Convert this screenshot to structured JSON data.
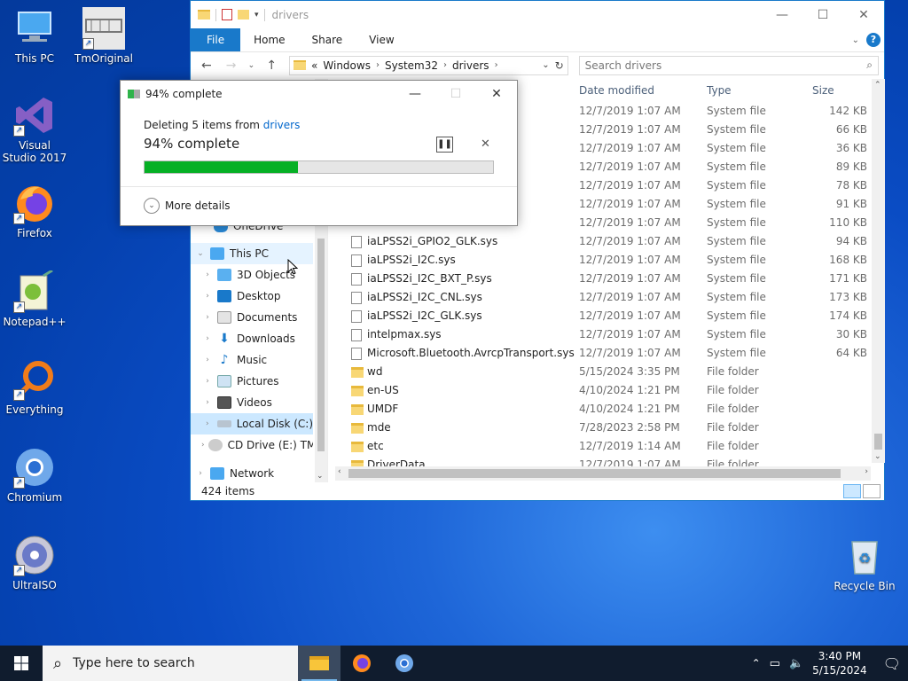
{
  "desktop": {
    "icons": [
      {
        "label": "This PC"
      },
      {
        "label": "TmOriginal"
      },
      {
        "label": "Visual Studio 2017"
      },
      {
        "label": "Firefox"
      },
      {
        "label": "Notepad++"
      },
      {
        "label": "Everything"
      },
      {
        "label": "Chromium"
      },
      {
        "label": "UltraISO"
      },
      {
        "label": "Recycle Bin"
      }
    ]
  },
  "explorer": {
    "title": "drivers",
    "tabs": [
      "File",
      "Home",
      "Share",
      "View"
    ],
    "address": {
      "prefix": "«",
      "crumbs": [
        "Windows",
        "System32",
        "drivers"
      ]
    },
    "search_placeholder": "Search drivers",
    "nav": {
      "onedrive": "OneDrive",
      "this_pc": "This PC",
      "items": [
        "3D Objects",
        "Desktop",
        "Documents",
        "Downloads",
        "Music",
        "Pictures",
        "Videos",
        "Local Disk (C:)",
        "CD Drive (E:) TM"
      ],
      "network": "Network"
    },
    "columns": {
      "date": "Date modified",
      "type": "Type",
      "size": "Size"
    },
    "rows": [
      {
        "name": "",
        "date": "12/7/2019 1:07 AM",
        "type": "System file",
        "size": "142 KB"
      },
      {
        "name": "",
        "date": "12/7/2019 1:07 AM",
        "type": "System file",
        "size": "66 KB"
      },
      {
        "name": "",
        "date": "12/7/2019 1:07 AM",
        "type": "System file",
        "size": "36 KB"
      },
      {
        "name": "",
        "date": "12/7/2019 1:07 AM",
        "type": "System file",
        "size": "89 KB"
      },
      {
        "name": "",
        "date": "12/7/2019 1:07 AM",
        "type": "System file",
        "size": "78 KB"
      },
      {
        "name": "",
        "date": "12/7/2019 1:07 AM",
        "type": "System file",
        "size": "91 KB"
      },
      {
        "name": "",
        "date": "12/7/2019 1:07 AM",
        "type": "System file",
        "size": "110 KB"
      },
      {
        "name": "iaLPSS2i_GPIO2_GLK.sys",
        "date": "12/7/2019 1:07 AM",
        "type": "System file",
        "size": "94 KB"
      },
      {
        "name": "iaLPSS2i_I2C.sys",
        "date": "12/7/2019 1:07 AM",
        "type": "System file",
        "size": "168 KB"
      },
      {
        "name": "iaLPSS2i_I2C_BXT_P.sys",
        "date": "12/7/2019 1:07 AM",
        "type": "System file",
        "size": "171 KB"
      },
      {
        "name": "iaLPSS2i_I2C_CNL.sys",
        "date": "12/7/2019 1:07 AM",
        "type": "System file",
        "size": "173 KB"
      },
      {
        "name": "iaLPSS2i_I2C_GLK.sys",
        "date": "12/7/2019 1:07 AM",
        "type": "System file",
        "size": "174 KB"
      },
      {
        "name": "intelpmax.sys",
        "date": "12/7/2019 1:07 AM",
        "type": "System file",
        "size": "30 KB"
      },
      {
        "name": "Microsoft.Bluetooth.AvrcpTransport.sys",
        "date": "12/7/2019 1:07 AM",
        "type": "System file",
        "size": "64 KB"
      },
      {
        "name": "wd",
        "date": "5/15/2024 3:35 PM",
        "type": "File folder",
        "size": ""
      },
      {
        "name": "en-US",
        "date": "4/10/2024 1:21 PM",
        "type": "File folder",
        "size": ""
      },
      {
        "name": "UMDF",
        "date": "4/10/2024 1:21 PM",
        "type": "File folder",
        "size": ""
      },
      {
        "name": "mde",
        "date": "7/28/2023 2:58 PM",
        "type": "File folder",
        "size": ""
      },
      {
        "name": "etc",
        "date": "12/7/2019 1:14 AM",
        "type": "File folder",
        "size": ""
      },
      {
        "name": "DriverData",
        "date": "12/7/2019 1:07 AM",
        "type": "File folder",
        "size": ""
      }
    ],
    "status": "424 items"
  },
  "dialog": {
    "title": "94% complete",
    "line_prefix": "Deleting 5 items from ",
    "line_link": "drivers",
    "big": "94% complete",
    "progress": 0.44,
    "more_details": "More details"
  },
  "taskbar": {
    "search_placeholder": "Type here to search",
    "time": "3:40 PM",
    "date": "5/15/2024"
  }
}
